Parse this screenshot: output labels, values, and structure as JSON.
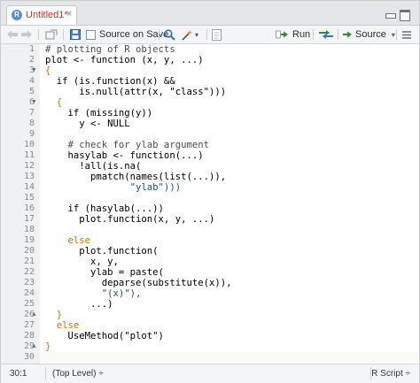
{
  "tab": {
    "title": "Untitled1*",
    "close": "×"
  },
  "toolbar": {
    "source_on_save": "Source on Save",
    "run": "Run",
    "source": "Source"
  },
  "editor": {
    "line_numbers": [
      "1",
      "2",
      "3",
      "4",
      "5",
      "6",
      "7",
      "8",
      "9",
      "10",
      "11",
      "12",
      "13",
      "14",
      "15",
      "16",
      "17",
      "18",
      "19",
      "20",
      "21",
      "22",
      "23",
      "24",
      "25",
      "26",
      "27",
      "28",
      "29",
      "30"
    ],
    "lines": [
      "# plotting of R objects",
      "plot <- function (x, y, ...)",
      "{",
      "  if (is.function(x) &&",
      "      is.null(attr(x, \"class\")))",
      "  {",
      "    if (missing(y))",
      "      y <- NULL",
      "",
      "    # check for ylab argument",
      "    hasylab <- function(...)",
      "      !all(is.na(",
      "        pmatch(names(list(...)),",
      "               \"ylab\")))",
      "",
      "    if (hasylab(...))",
      "      plot.function(x, y, ...)",
      "",
      "    else",
      "      plot.function(",
      "        x, y,",
      "        ylab = paste(",
      "          deparse(substitute(x)),",
      "          \"(x)\"),",
      "        ...)",
      "  }",
      "  else",
      "    UseMethod(\"plot\")",
      "}",
      ""
    ]
  },
  "status": {
    "position": "30:1",
    "scope": "(Top Level) ÷",
    "file_type": "R Script ÷"
  },
  "icons": [
    "back-arrow-icon",
    "forward-arrow-icon",
    "show-in-window-icon",
    "save-icon",
    "search-icon",
    "magic-wand-icon",
    "compile-report-icon",
    "run-arrow-icon",
    "rerun-icon",
    "source-arrow-icon",
    "outline-icon"
  ]
}
